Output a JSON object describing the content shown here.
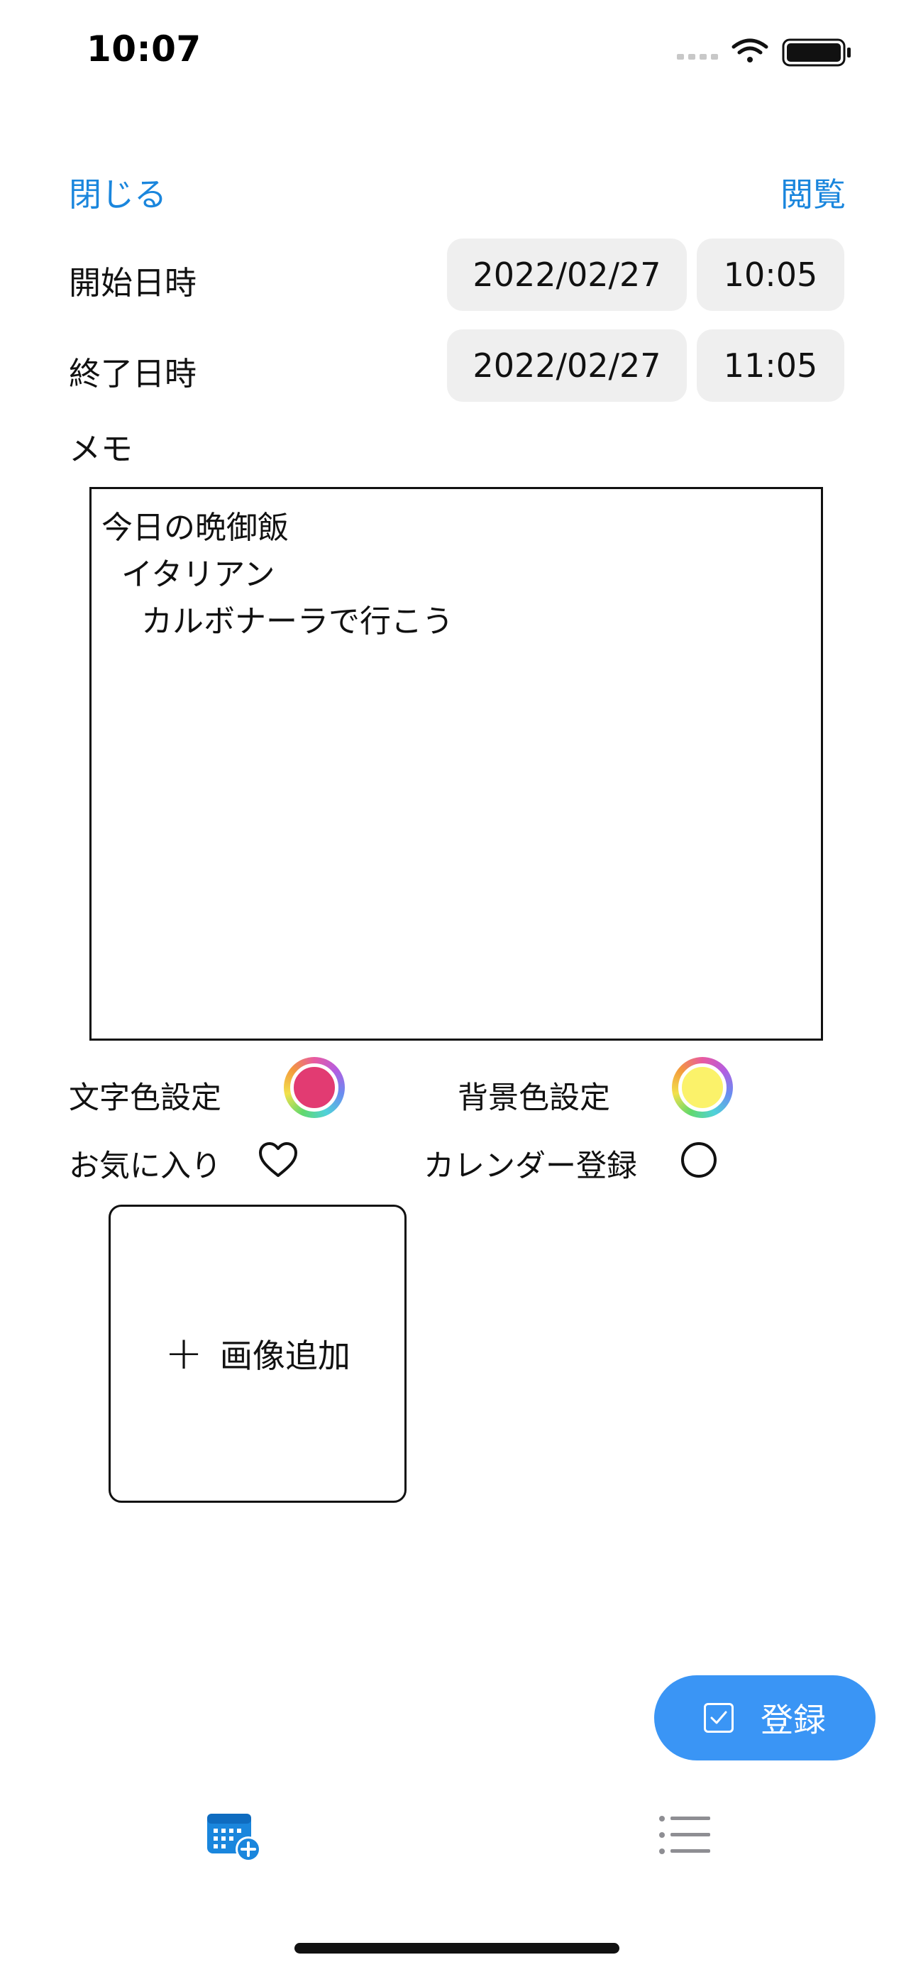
{
  "status_bar": {
    "time": "10:07"
  },
  "nav": {
    "close_label": "閉じる",
    "view_label": "閲覧"
  },
  "start": {
    "label": "開始日時",
    "date": "2022/02/27",
    "time": "10:05"
  },
  "end": {
    "label": "終了日時",
    "date": "2022/02/27",
    "time": "11:05"
  },
  "memo": {
    "label": "メモ",
    "text": "今日の晩御飯\n  イタリアン\n    カルボナーラで行こう"
  },
  "options": {
    "text_color_label": "文字色設定",
    "text_color": "#e23b72",
    "bg_color_label": "背景色設定",
    "bg_color": "#fbf26a",
    "favorite_label": "お気に入り",
    "calendar_label": "カレンダー登録"
  },
  "image": {
    "add_label": "画像追加"
  },
  "register": {
    "label": "登録"
  },
  "colors": {
    "accent": "#1a86dd",
    "button": "#3a95f5",
    "tab_inactive": "#8e8e93"
  },
  "tabs": [
    {
      "icon": "calendar-add-icon",
      "active": true
    },
    {
      "icon": "list-icon",
      "active": false
    }
  ]
}
